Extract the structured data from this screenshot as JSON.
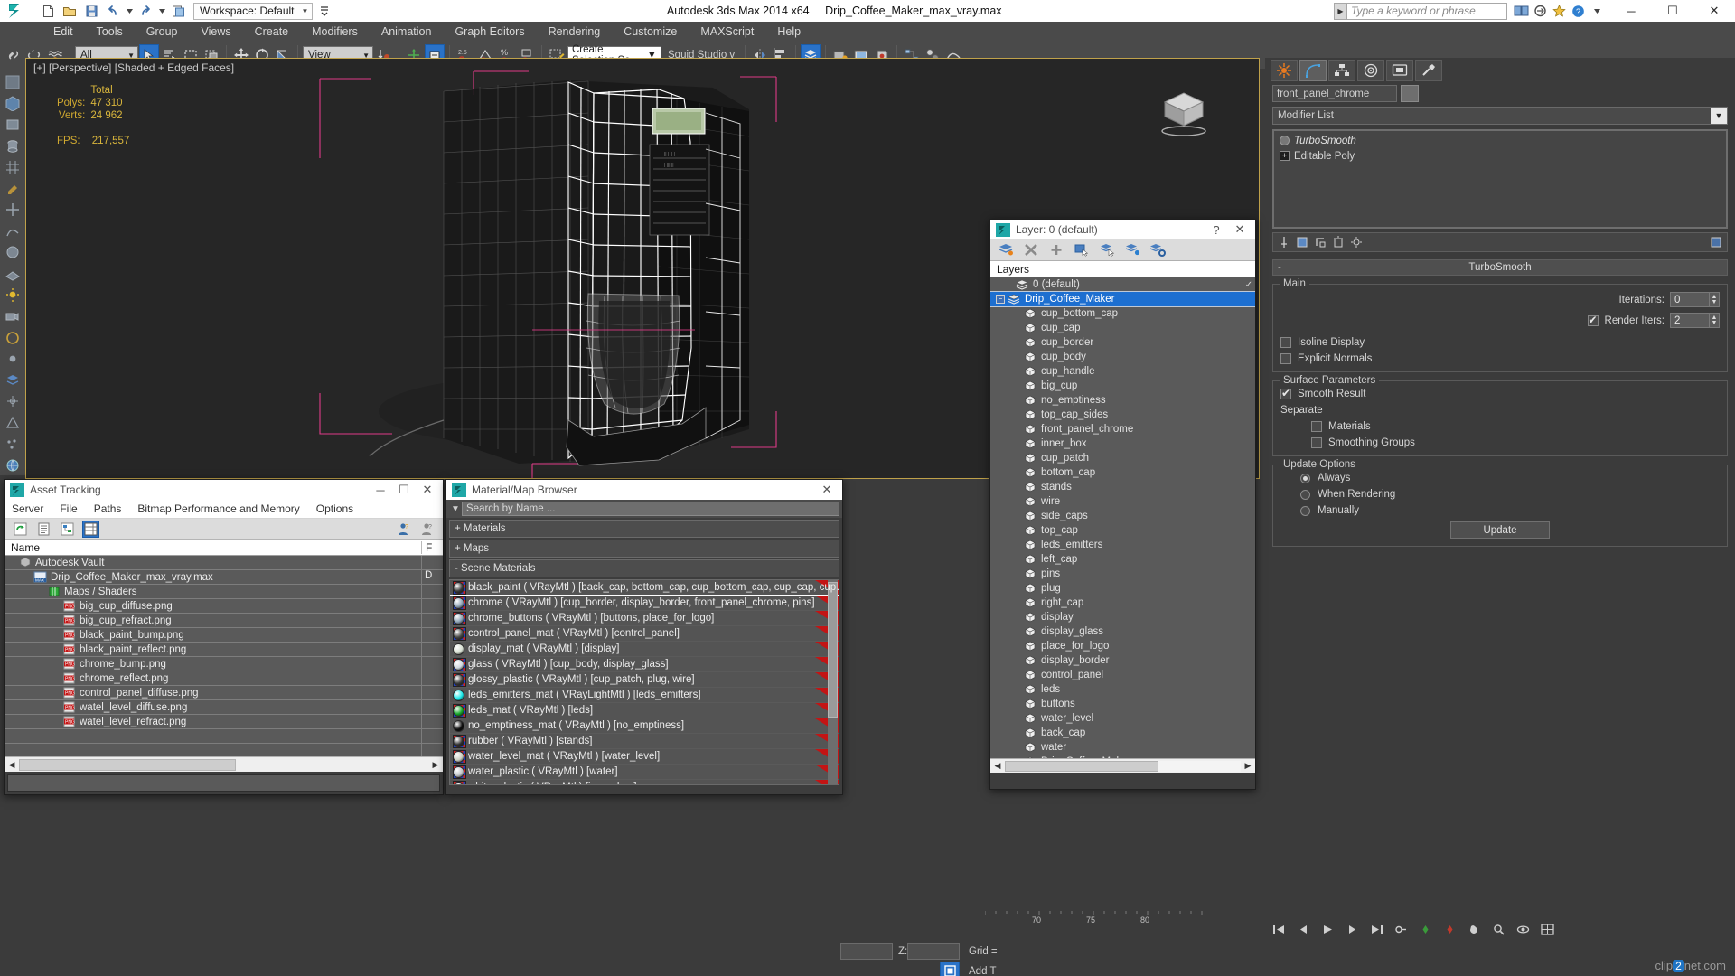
{
  "titlebar": {
    "app_title": "Autodesk 3ds Max  2014 x64",
    "file_name": "Drip_Coffee_Maker_max_vray.max",
    "workspace_label": "Workspace: Default",
    "search_placeholder": "Type a keyword or phrase",
    "minimize": "─",
    "maximize": "☐",
    "close": "✕"
  },
  "menubar": {
    "items": [
      "Edit",
      "Tools",
      "Group",
      "Views",
      "Create",
      "Modifiers",
      "Animation",
      "Graph Editors",
      "Rendering",
      "Customize",
      "MAXScript",
      "Help"
    ]
  },
  "toolbar": {
    "filter_combo": "All",
    "reference_combo": "View",
    "selection_set_placeholder": "Create Selection Se",
    "named_set": "Squid Studio v"
  },
  "viewport": {
    "label": "[+] [Perspective] [Shaded + Edged Faces]",
    "stats_header": "Total",
    "polys_label": "Polys:",
    "polys_value": "47 310",
    "verts_label": "Verts:",
    "verts_value": "24 962",
    "fps_label": "FPS:",
    "fps_value": "217,557"
  },
  "command_panel": {
    "object_name": "front_panel_chrome",
    "modifier_list_label": "Modifier List",
    "stack": [
      {
        "label": "TurboSmooth",
        "italic": true
      },
      {
        "label": "Editable Poly",
        "italic": false
      }
    ],
    "rollout_title": "TurboSmooth",
    "groups": {
      "main_title": "Main",
      "iterations_label": "Iterations:",
      "iterations_value": "0",
      "render_iters_label": "Render Iters:",
      "render_iters_value": "2",
      "render_iters_checked": true,
      "isoline_label": "Isoline Display",
      "isoline_checked": false,
      "explicit_normals_label": "Explicit Normals",
      "explicit_normals_checked": false,
      "surface_title": "Surface Parameters",
      "smooth_result_label": "Smooth Result",
      "smooth_result_checked": true,
      "separate_label": "Separate",
      "materials_label": "Materials",
      "materials_checked": false,
      "smoothing_groups_label": "Smoothing Groups",
      "smoothing_groups_checked": false,
      "update_title": "Update Options",
      "always_label": "Always",
      "when_rendering_label": "When Rendering",
      "manually_label": "Manually",
      "update_selected": "Always",
      "update_button": "Update"
    }
  },
  "layer_window": {
    "title": "Layer: 0 (default)",
    "help_glyph": "?",
    "close_glyph": "✕",
    "column_header": "Layers",
    "rows": [
      {
        "label": "0 (default)",
        "indent": 1,
        "type": "layer",
        "selected": false,
        "check": "✓"
      },
      {
        "label": "Drip_Coffee_Maker",
        "indent": 0,
        "type": "layer",
        "selected": true,
        "expander": "−",
        "check": ""
      },
      {
        "label": "cup_bottom_cap",
        "indent": 2,
        "type": "object",
        "selected": false
      },
      {
        "label": "cup_cap",
        "indent": 2,
        "type": "object",
        "selected": false
      },
      {
        "label": "cup_border",
        "indent": 2,
        "type": "object",
        "selected": false
      },
      {
        "label": "cup_body",
        "indent": 2,
        "type": "object",
        "selected": false
      },
      {
        "label": "cup_handle",
        "indent": 2,
        "type": "object",
        "selected": false
      },
      {
        "label": "big_cup",
        "indent": 2,
        "type": "object",
        "selected": false
      },
      {
        "label": "no_emptiness",
        "indent": 2,
        "type": "object",
        "selected": false
      },
      {
        "label": "top_cap_sides",
        "indent": 2,
        "type": "object",
        "selected": false
      },
      {
        "label": "front_panel_chrome",
        "indent": 2,
        "type": "object",
        "selected": false
      },
      {
        "label": "inner_box",
        "indent": 2,
        "type": "object",
        "selected": false
      },
      {
        "label": "cup_patch",
        "indent": 2,
        "type": "object",
        "selected": false
      },
      {
        "label": "bottom_cap",
        "indent": 2,
        "type": "object",
        "selected": false
      },
      {
        "label": "stands",
        "indent": 2,
        "type": "object",
        "selected": false
      },
      {
        "label": "wire",
        "indent": 2,
        "type": "object",
        "selected": false
      },
      {
        "label": "side_caps",
        "indent": 2,
        "type": "object",
        "selected": false
      },
      {
        "label": "top_cap",
        "indent": 2,
        "type": "object",
        "selected": false
      },
      {
        "label": "leds_emitters",
        "indent": 2,
        "type": "object",
        "selected": false
      },
      {
        "label": "left_cap",
        "indent": 2,
        "type": "object",
        "selected": false
      },
      {
        "label": "pins",
        "indent": 2,
        "type": "object",
        "selected": false
      },
      {
        "label": "plug",
        "indent": 2,
        "type": "object",
        "selected": false
      },
      {
        "label": "right_cap",
        "indent": 2,
        "type": "object",
        "selected": false
      },
      {
        "label": "display",
        "indent": 2,
        "type": "object",
        "selected": false
      },
      {
        "label": "display_glass",
        "indent": 2,
        "type": "object",
        "selected": false
      },
      {
        "label": "place_for_logo",
        "indent": 2,
        "type": "object",
        "selected": false
      },
      {
        "label": "display_border",
        "indent": 2,
        "type": "object",
        "selected": false
      },
      {
        "label": "control_panel",
        "indent": 2,
        "type": "object",
        "selected": false
      },
      {
        "label": "leds",
        "indent": 2,
        "type": "object",
        "selected": false
      },
      {
        "label": "buttons",
        "indent": 2,
        "type": "object",
        "selected": false
      },
      {
        "label": "water_level",
        "indent": 2,
        "type": "object",
        "selected": false
      },
      {
        "label": "back_cap",
        "indent": 2,
        "type": "object",
        "selected": false
      },
      {
        "label": "water",
        "indent": 2,
        "type": "object",
        "selected": false
      },
      {
        "label": "Drip_Coffee_Maker",
        "indent": 2,
        "type": "object",
        "selected": false
      }
    ]
  },
  "asset_window": {
    "title": "Asset Tracking",
    "minimize": "─",
    "maximize": "☐",
    "close": "✕",
    "menu": [
      "Server",
      "File",
      "Paths",
      "Bitmap Performance and Memory",
      "Options"
    ],
    "col_name": "Name",
    "col_f": "F",
    "rows": [
      {
        "label": "Autodesk Vault",
        "indent": 1,
        "icon": "vault-icon",
        "f": ""
      },
      {
        "label": "Drip_Coffee_Maker_max_vray.max",
        "indent": 2,
        "icon": "max-file-icon",
        "f": "D"
      },
      {
        "label": "Maps / Shaders",
        "indent": 3,
        "icon": "maps-icon",
        "f": ""
      },
      {
        "label": "big_cup_diffuse.png",
        "indent": 4,
        "icon": "png-icon",
        "f": ""
      },
      {
        "label": "big_cup_refract.png",
        "indent": 4,
        "icon": "png-icon",
        "f": ""
      },
      {
        "label": "black_paint_bump.png",
        "indent": 4,
        "icon": "png-icon",
        "f": ""
      },
      {
        "label": "black_paint_reflect.png",
        "indent": 4,
        "icon": "png-icon",
        "f": ""
      },
      {
        "label": "chrome_bump.png",
        "indent": 4,
        "icon": "png-icon",
        "f": ""
      },
      {
        "label": "chrome_reflect.png",
        "indent": 4,
        "icon": "png-icon",
        "f": ""
      },
      {
        "label": "control_panel_diffuse.png",
        "indent": 4,
        "icon": "png-icon",
        "f": ""
      },
      {
        "label": "watel_level_diffuse.png",
        "indent": 4,
        "icon": "png-icon",
        "f": ""
      },
      {
        "label": "watel_level_refract.png",
        "indent": 4,
        "icon": "png-icon",
        "f": ""
      },
      {
        "label": "",
        "indent": 0,
        "icon": "",
        "f": ""
      },
      {
        "label": "",
        "indent": 0,
        "icon": "",
        "f": ""
      }
    ]
  },
  "material_window": {
    "title": "Material/Map Browser",
    "close_glyph": "✕",
    "search_placeholder": "Search by Name ...",
    "group_materials": "+ Materials",
    "group_maps": "+ Maps",
    "group_scene": "-  Scene Materials",
    "materials": [
      {
        "label": "black_paint  ( VRayMtl )  [back_cap, bottom_cap, cup_bottom_cap, cup_cap, cup…",
        "swatch": "#3a3a3a",
        "checker": true,
        "selected": false
      },
      {
        "label": "chrome  ( VRayMtl )  [cup_border, display_border, front_panel_chrome, pins]",
        "swatch": "#8fa3b5",
        "checker": true,
        "selected": true
      },
      {
        "label": "chrome_buttons  ( VRayMtl )  [buttons, place_for_logo]",
        "swatch": "#8fa3b5",
        "checker": true,
        "selected": false
      },
      {
        "label": "control_panel_mat  ( VRayMtl )  [control_panel]",
        "swatch": "#4a4a48",
        "checker": true,
        "selected": false
      },
      {
        "label": "display_mat  ( VRayMtl )  [display]",
        "swatch": "#d8e0d2",
        "checker": false,
        "selected": false
      },
      {
        "label": "glass  ( VRayMtl )  [cup_body, display_glass]",
        "swatch": "#cfd8de",
        "checker": true,
        "selected": false
      },
      {
        "label": "glossy_plastic  ( VRayMtl )  [cup_patch, plug, wire]",
        "swatch": "#3d3d3d",
        "checker": true,
        "selected": false
      },
      {
        "label": "leds_emitters_mat  ( VRayLightMtl )  [leds_emitters]",
        "swatch": "#17e8e8",
        "checker": false,
        "selected": false
      },
      {
        "label": "leds_mat  ( VRayMtl )  [leds]",
        "swatch": "#15a82a",
        "checker": true,
        "selected": false
      },
      {
        "label": "no_emptiness_mat  ( VRayMtl )  [no_emptiness]",
        "swatch": "#0c0c0c",
        "checker": false,
        "selected": false
      },
      {
        "label": "rubber  ( VRayMtl )  [stands]",
        "swatch": "#2f2f2f",
        "checker": true,
        "selected": false
      },
      {
        "label": "water_level_mat  ( VRayMtl )  [water_level]",
        "swatch": "#c9ccc0",
        "checker": true,
        "selected": false
      },
      {
        "label": "water_plastic  ( VRayMtl )  [water]",
        "swatch": "#bfc3c6",
        "checker": true,
        "selected": false
      },
      {
        "label": "white_plastic  ( VRayMtl )  [inner_box]",
        "swatch": "#e8e8e8",
        "checker": true,
        "selected": false
      }
    ]
  },
  "statusbar": {
    "z_label": "Z:",
    "grid_label": "Grid =",
    "add_time_tag": "Add T",
    "ruler_ticks": [
      "70",
      "75",
      "80"
    ]
  },
  "watermark": {
    "clip": "clip",
    "two": "2",
    "net": "net.com"
  }
}
